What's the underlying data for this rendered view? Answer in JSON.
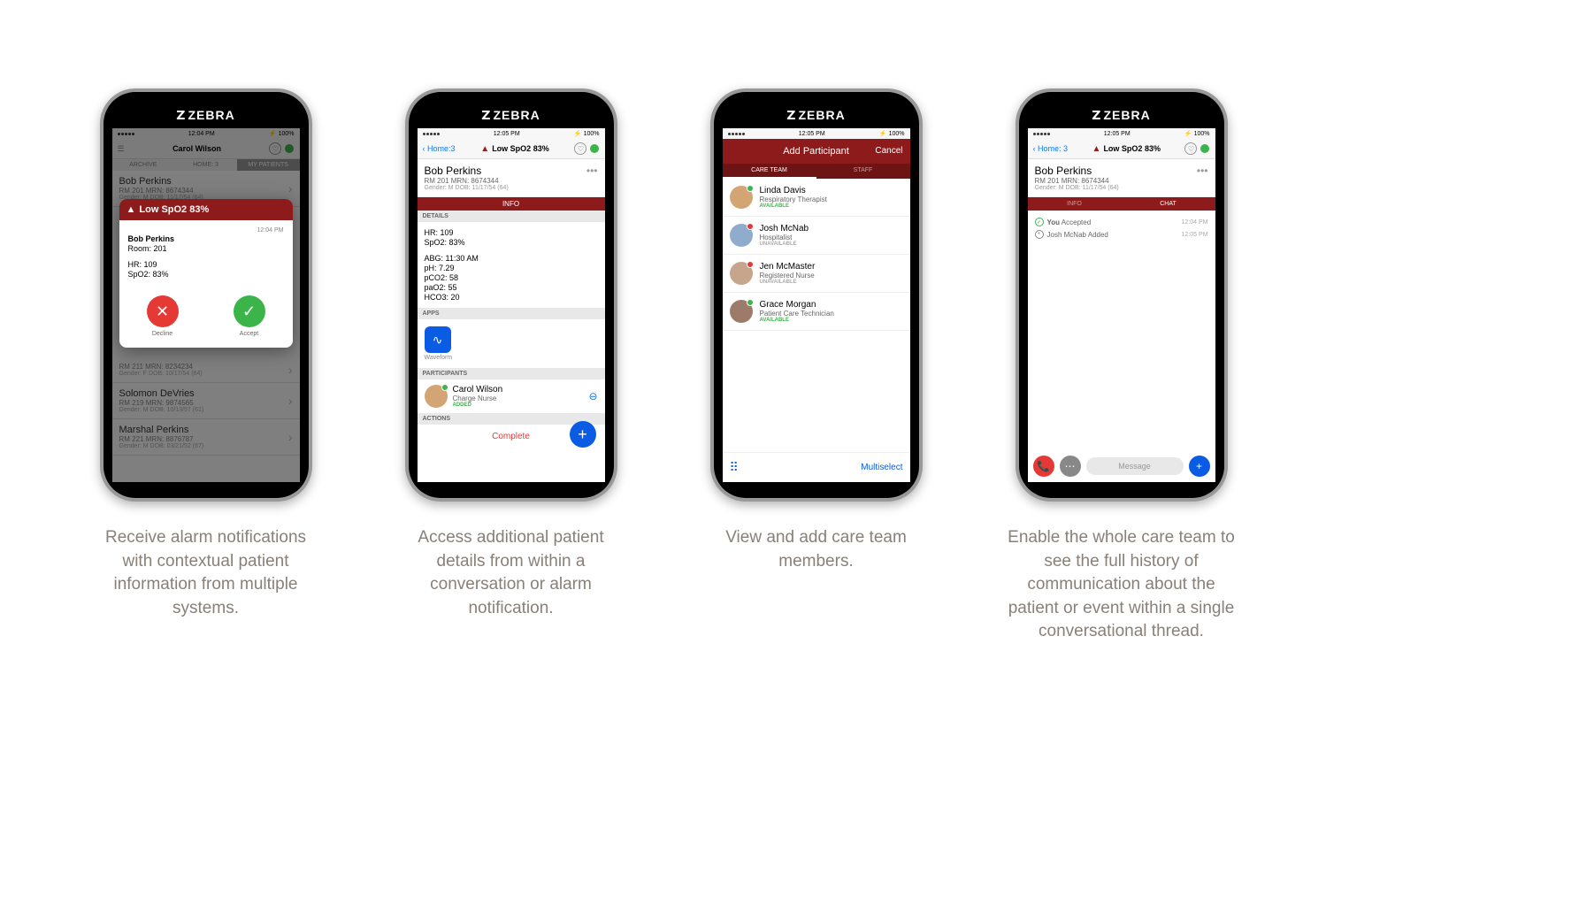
{
  "brand": "ZEBRA",
  "s1": {
    "time": "12:04 PM",
    "battery": "100%",
    "titleUser": "Carol Wilson",
    "tabs": [
      "ARCHIVE",
      "HOME: 3",
      "MY PATIENTS"
    ],
    "activeTab": 2,
    "patients": [
      {
        "name": "Bob Perkins",
        "rm": "RM 201",
        "mrn": "MRN: 8674344",
        "meta": "Gender: M  DOB: 11/17/54 (64)"
      },
      {
        "name": "",
        "rm": "RM 211",
        "mrn": "MRN: 8234234",
        "meta": "Gender: F  DOB: 10/17/54 (64)"
      },
      {
        "name": "Solomon DeVries",
        "rm": "RM 219",
        "mrn": "MRN: 9874565",
        "meta": "Gender: M  DOB: 10/13/57 (61)"
      },
      {
        "name": "Marshal Perkins",
        "rm": "RM 221",
        "mrn": "MRN: 8876787",
        "meta": "Gender: M  DOB: 03/21/52 (67)"
      }
    ],
    "alert": {
      "title": "Low SpO2  83%",
      "time": "12:04 PM",
      "name": "Bob Perkins",
      "room": "Room: 201",
      "hr": "HR: 109",
      "spo2": "SpO2: 83%",
      "decline": "Decline",
      "accept": "Accept"
    }
  },
  "s2": {
    "time": "12:05 PM",
    "battery": "100%",
    "back": "Home:3",
    "title": "Low SpO2 83%",
    "patient": {
      "name": "Bob Perkins",
      "line2": "RM 201   MRN: 8674344",
      "line3": "Gender: M   DOB: 11/17/54 (64)"
    },
    "infoTab": "INFO",
    "sections": {
      "details": "DETAILS",
      "apps": "APPS",
      "participants": "PARTICIPANTS",
      "actions": "ACTIONS"
    },
    "details": [
      "HR: 109",
      "SpO2: 83%",
      "",
      "ABG: 11:30 AM",
      "pH: 7.29",
      "pCO2: 58",
      "paO2: 55",
      "HCO3: 20"
    ],
    "appLabel": "Waveform",
    "participant": {
      "name": "Carol Wilson",
      "role": "Charge Nurse",
      "status": "ADDED"
    },
    "complete": "Complete"
  },
  "s3": {
    "time": "12:05 PM",
    "battery": "100%",
    "title": "Add Participant",
    "cancel": "Cancel",
    "tabs": [
      "CARE TEAM",
      "STAFF"
    ],
    "activeTab": 0,
    "staff": [
      {
        "name": "Linda Davis",
        "role": "Respiratory Therapist",
        "status": "AVAILABLE",
        "online": true
      },
      {
        "name": "Josh McNab",
        "role": "Hospitalist",
        "status": "UNAVAILABLE",
        "online": false
      },
      {
        "name": "Jen McMaster",
        "role": "Registered Nurse",
        "status": "UNAVAILABLE",
        "online": false
      },
      {
        "name": "Grace Morgan",
        "role": "Patient Care Technician",
        "status": "AVAILABLE",
        "online": true
      }
    ],
    "multiselect": "Multiselect"
  },
  "s4": {
    "time": "12:05 PM",
    "battery": "100%",
    "back": "Home: 3",
    "title": "Low SpO2 83%",
    "patient": {
      "name": "Bob Perkins",
      "line2": "RM 201   MRN: 8674344",
      "line3": "Gender: M   DOB: 11/17/54 (64)"
    },
    "tabs": [
      "INFO",
      "CHAT"
    ],
    "activeTab": 1,
    "log": [
      {
        "icon": "check",
        "text": "You Accepted",
        "time": "12:04 PM"
      },
      {
        "icon": "plus",
        "text": "Josh McNab Added",
        "time": "12:05 PM"
      }
    ],
    "msgPlaceholder": "Message"
  },
  "captions": [
    "Receive alarm notifications with contextual patient information  from multiple systems.",
    "Access additional patient details from within a conversation or alarm notification.",
    "View and add care team members.",
    "Enable the whole care team to see the full history of communication about the patient or event within a single conversational thread."
  ]
}
